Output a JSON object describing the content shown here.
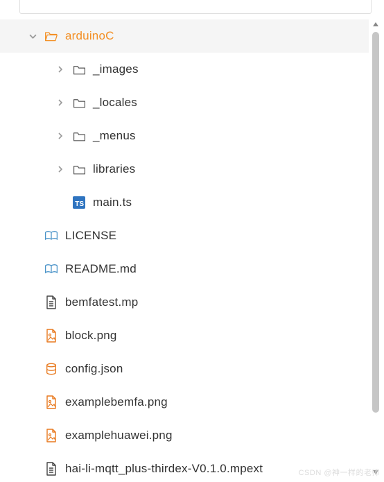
{
  "tree": {
    "root": {
      "label": "arduinoC",
      "children": [
        {
          "label": "_images",
          "type": "folder"
        },
        {
          "label": "_locales",
          "type": "folder"
        },
        {
          "label": "_menus",
          "type": "folder"
        },
        {
          "label": "libraries",
          "type": "folder"
        },
        {
          "label": "main.ts",
          "type": "ts"
        }
      ]
    },
    "siblings": [
      {
        "label": "LICENSE",
        "type": "book"
      },
      {
        "label": "README.md",
        "type": "book"
      },
      {
        "label": "bemfatest.mp",
        "type": "doc"
      },
      {
        "label": "block.png",
        "type": "img"
      },
      {
        "label": "config.json",
        "type": "db"
      },
      {
        "label": "examplebemfa.png",
        "type": "img"
      },
      {
        "label": "examplehuawei.png",
        "type": "img"
      },
      {
        "label": "hai-li-mqtt_plus-thirdex-V0.1.0.mpext",
        "type": "doc"
      }
    ]
  },
  "icons": {
    "ts_badge": "TS"
  },
  "watermark": "CSDN @神一样的老师"
}
